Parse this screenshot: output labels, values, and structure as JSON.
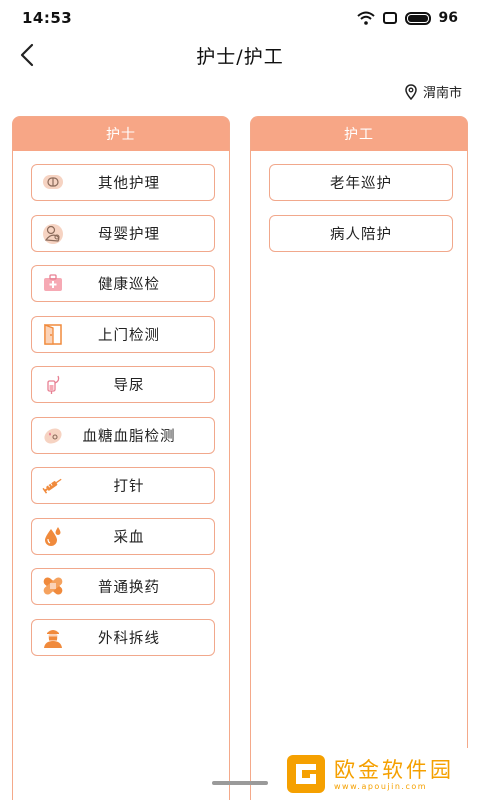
{
  "status": {
    "time": "14:53",
    "battery": "96"
  },
  "header": {
    "title": "护士/护工"
  },
  "location": {
    "city": "渭南市"
  },
  "left_panel": {
    "title": "护士",
    "items": [
      {
        "label": "其他护理",
        "icon": "capsule-bandage-icon"
      },
      {
        "label": "母婴护理",
        "icon": "mother-baby-icon"
      },
      {
        "label": "健康巡检",
        "icon": "medical-kit-icon"
      },
      {
        "label": "上门检测",
        "icon": "door-icon"
      },
      {
        "label": "导尿",
        "icon": "catheter-icon"
      },
      {
        "label": "血糖血脂检测",
        "icon": "blood-glucose-icon"
      },
      {
        "label": "打针",
        "icon": "syringe-icon"
      },
      {
        "label": "采血",
        "icon": "blood-drop-icon"
      },
      {
        "label": "普通换药",
        "icon": "bandage-icon"
      },
      {
        "label": "外科拆线",
        "icon": "surgeon-icon"
      }
    ]
  },
  "right_panel": {
    "title": "护工",
    "items": [
      {
        "label": "老年巡护"
      },
      {
        "label": "病人陪护"
      }
    ]
  },
  "watermark": {
    "main": "欧金软件园",
    "url": "www.apoujin.com"
  },
  "colors": {
    "accent": "#f7a686",
    "border": "#f1a88c",
    "icon_orange": "#f08a3c",
    "watermark": "#f5a000"
  }
}
